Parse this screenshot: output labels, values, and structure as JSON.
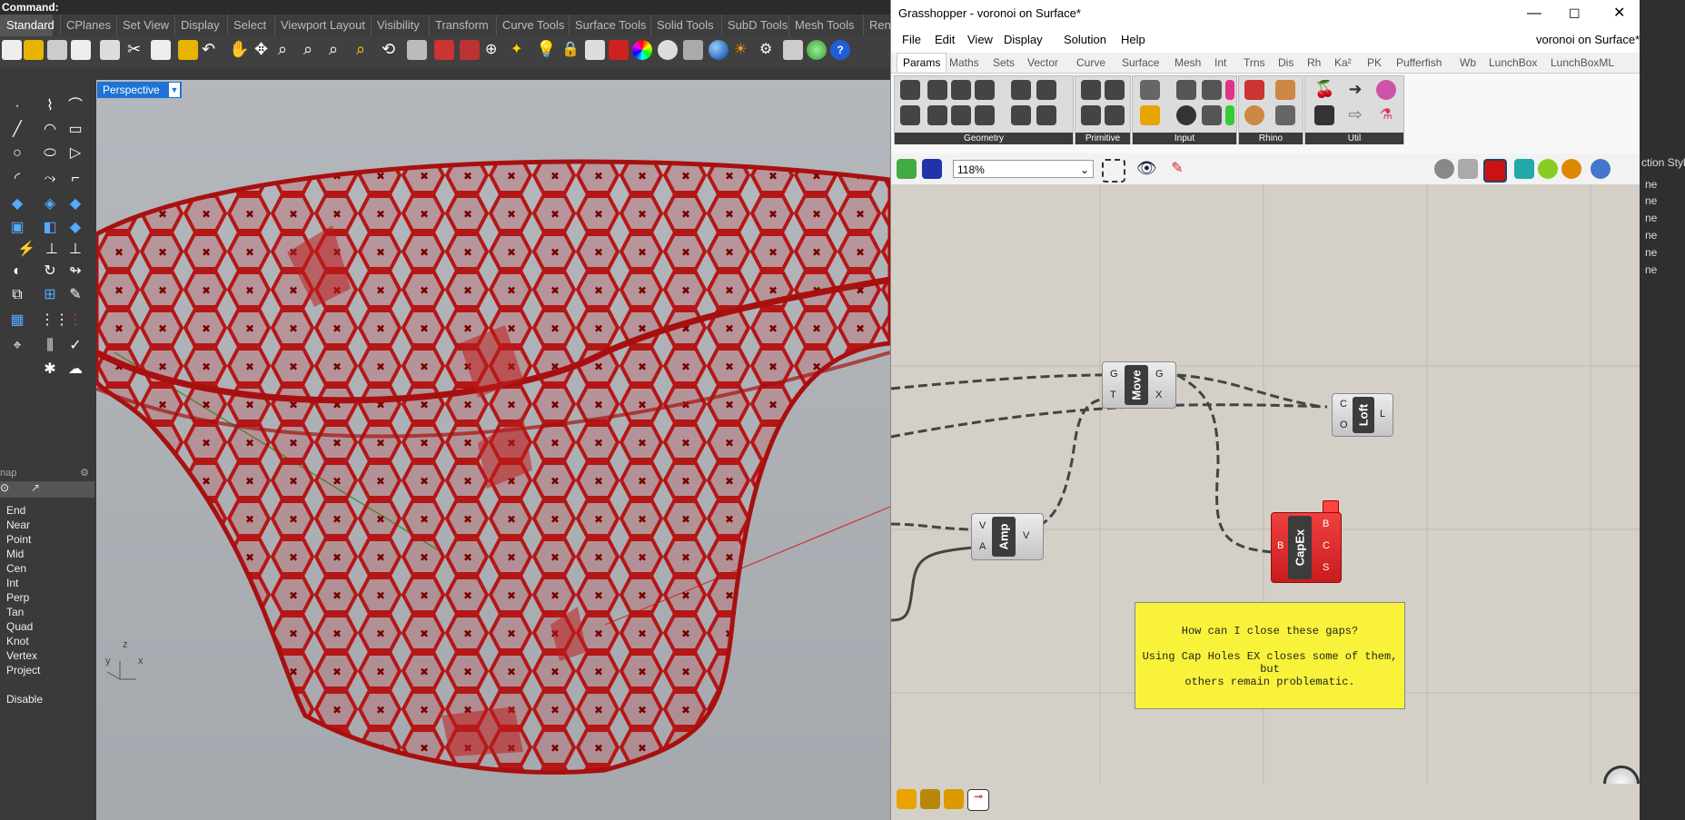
{
  "rhino": {
    "command_label": "Command:",
    "tabs": [
      "Standard",
      "CPlanes",
      "Set View",
      "Display",
      "Select",
      "Viewport Layout",
      "Visibility",
      "Transform",
      "Curve Tools",
      "Surface Tools",
      "Solid Tools",
      "SubD Tools",
      "Mesh Tools",
      "Ren"
    ],
    "viewport_label": "Perspective",
    "snap_header": "nap",
    "osnaps": [
      "End",
      "Near",
      "Point",
      "Mid",
      "Cen",
      "Int",
      "Perp",
      "Tan",
      "Quad",
      "Knot",
      "Vertex",
      "Project",
      "Disable"
    ],
    "axis": {
      "x": "x",
      "y": "y",
      "z": "z"
    }
  },
  "grasshopper": {
    "window_title": "Grasshopper - voronoi on Surface*",
    "doc_name": "voronoi on Surface*",
    "menu": [
      "File",
      "Edit",
      "View",
      "Display",
      "Solution",
      "Help"
    ],
    "tabs": [
      "Params",
      "Maths",
      "Sets",
      "Vector",
      "Curve",
      "Surface",
      "Mesh",
      "Int",
      "Trns",
      "Dis",
      "Rh",
      "Ka²",
      "PK",
      "Pufferfish",
      "Wb",
      "LunchBox",
      "LunchBoxML"
    ],
    "ribbon_groups": [
      "Geometry",
      "Primitive",
      "Input",
      "Rhino",
      "Util"
    ],
    "zoom": "118%",
    "components": {
      "move": {
        "name": "Move",
        "in": [
          "G",
          "T"
        ],
        "out": [
          "G",
          "X"
        ]
      },
      "loft": {
        "name": "Loft",
        "in": [
          "C",
          "O"
        ],
        "out": [
          "L"
        ]
      },
      "amp": {
        "name": "Amp",
        "in": [
          "V",
          "A"
        ],
        "out": [
          "V"
        ]
      },
      "capex": {
        "name": "CapEx",
        "in": [
          "B"
        ],
        "out": [
          "B",
          "C",
          "S"
        ]
      }
    },
    "note": {
      "line1": "How can I close these gaps?",
      "line2": "Using Cap Holes EX closes some of them, but",
      "line3": "others remain problematic."
    }
  },
  "right_panel": {
    "header": "ction Style",
    "rows": [
      "ne",
      "ne",
      "ne",
      "ne",
      "ne",
      "ne"
    ]
  },
  "colors": {
    "mesh_red": "#c01818",
    "note_yellow": "#f8f33a",
    "viewport_blue": "#1e73d6"
  }
}
